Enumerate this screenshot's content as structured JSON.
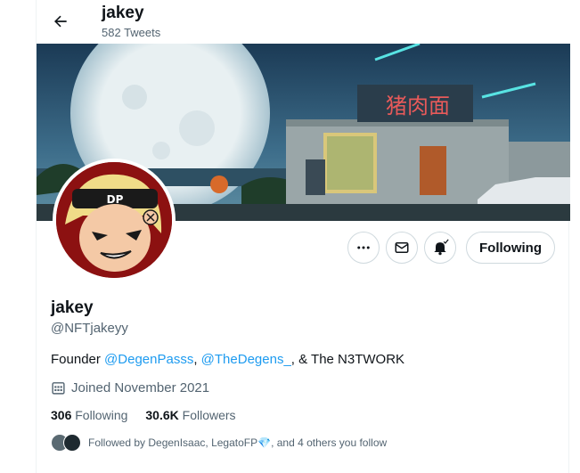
{
  "header": {
    "title": "jakey",
    "tweet_count": "582 Tweets"
  },
  "banner": {
    "sign_text": "猪肉面"
  },
  "actions": {
    "following_label": "Following"
  },
  "profile": {
    "display_name": "jakey",
    "handle": "@NFTjakeyy",
    "bio_prefix": "Founder ",
    "bio_link1": "@DegenPasss",
    "bio_sep": ", ",
    "bio_link2": "@TheDegens_",
    "bio_suffix": ", & The N3TWORK",
    "joined": "Joined November 2021"
  },
  "stats": {
    "following_count": "306",
    "following_label": "Following",
    "followers_count": "30.6K",
    "followers_label": "Followers"
  },
  "followed_by": {
    "text_prefix": "Followed by DegenIsaac, LegatoFP",
    "text_suffix": ", and 4 others you follow"
  },
  "colors": {
    "link": "#1d9bf0",
    "secondary_text": "#536471",
    "primary_text": "#0f1419"
  }
}
